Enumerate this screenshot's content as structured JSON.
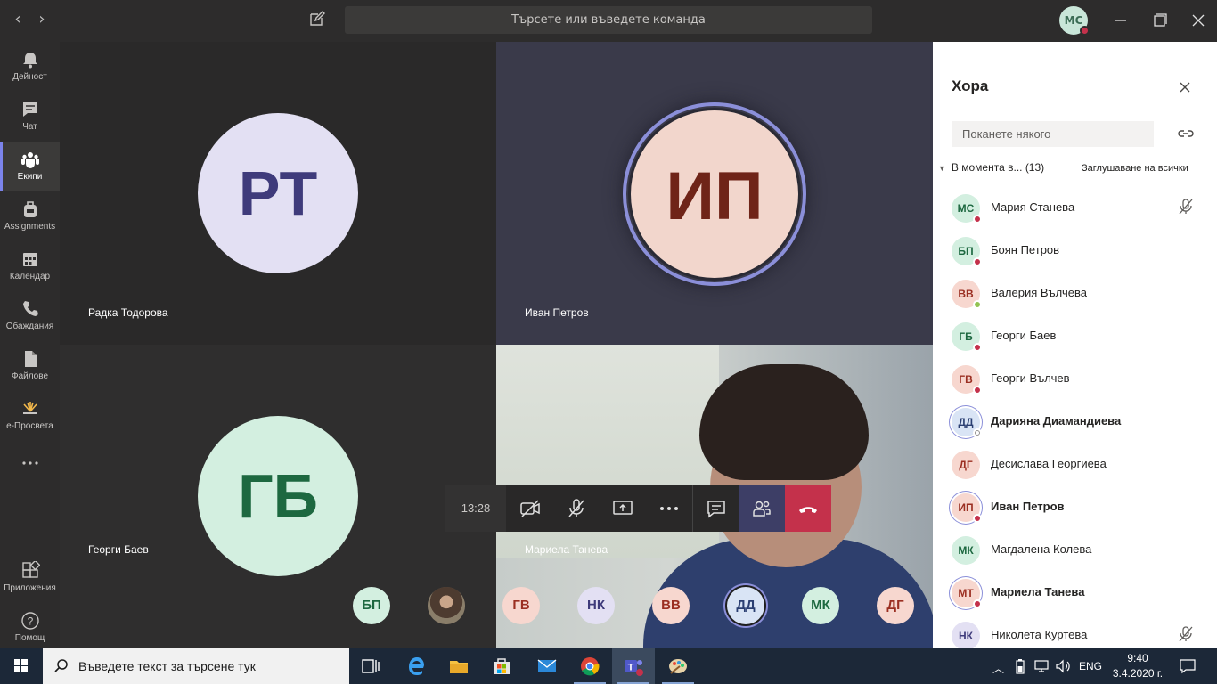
{
  "titlebar": {
    "search_placeholder": "Търсете или въведете команда",
    "user_initials": "МС"
  },
  "rail": {
    "items": [
      {
        "label": "Дейност",
        "icon": "bell-icon"
      },
      {
        "label": "Чат",
        "icon": "chat-icon"
      },
      {
        "label": "Екипи",
        "icon": "teams-icon"
      },
      {
        "label": "Assignments",
        "icon": "backpack-icon"
      },
      {
        "label": "Календар",
        "icon": "calendar-icon"
      },
      {
        "label": "Обаждания",
        "icon": "phone-icon"
      },
      {
        "label": "Файлове",
        "icon": "file-icon"
      },
      {
        "label": "е-Просвета",
        "icon": "eprosveta-icon"
      },
      {
        "label": "Приложения",
        "icon": "apps-icon"
      },
      {
        "label": "Помощ",
        "icon": "help-icon"
      }
    ],
    "active": "Екипи"
  },
  "tiles": {
    "rt": {
      "initials": "РТ",
      "name": "Радка Тодорова"
    },
    "ip": {
      "initials": "ИП",
      "name": "Иван Петров"
    },
    "gb": {
      "initials": "ГБ",
      "name": "Георги Баев"
    },
    "mt": {
      "name": "Мариела Танева"
    }
  },
  "controls": {
    "timer": "13:28"
  },
  "strip": [
    "БП",
    "",
    "ГВ",
    "НК",
    "ВВ",
    "ДД",
    "МК",
    "ДГ"
  ],
  "panel": {
    "title": "Хора",
    "invite_placeholder": "Поканете някого",
    "section": "В момента в... (13)",
    "mute_all": "Заглушаване на всички",
    "people": [
      {
        "initials": "МС",
        "name": "Мария Станева",
        "status": "busy",
        "muted": true
      },
      {
        "initials": "БП",
        "name": "Боян Петров",
        "status": "busy"
      },
      {
        "initials": "ВВ",
        "name": "Валерия Вълчева",
        "status": "available"
      },
      {
        "initials": "ГБ",
        "name": "Георги Баев",
        "status": "busy"
      },
      {
        "initials": "ГВ",
        "name": "Георги Вълчев",
        "status": "busy"
      },
      {
        "initials": "ДД",
        "name": "Дарияна Диамандиева",
        "status": "offline",
        "speaking": true
      },
      {
        "initials": "ДГ",
        "name": "Десислава Георгиева",
        "status": "none"
      },
      {
        "initials": "ИП",
        "name": "Иван Петров",
        "status": "busy",
        "speaking": true
      },
      {
        "initials": "МК",
        "name": "Магдалена Колева",
        "status": "none"
      },
      {
        "initials": "МТ",
        "name": "Мариела Танева",
        "status": "busy",
        "speaking": true
      },
      {
        "initials": "НК",
        "name": "Николета Куртева",
        "status": "none",
        "muted": true
      }
    ]
  },
  "taskbar": {
    "search_placeholder": "Въведете текст за търсене тук",
    "lang": "ENG",
    "time": "9:40",
    "date": "3.4.2020 г."
  },
  "colors": {
    "accent": "#6264a7",
    "busy": "#c4314b",
    "available": "#92c353"
  }
}
